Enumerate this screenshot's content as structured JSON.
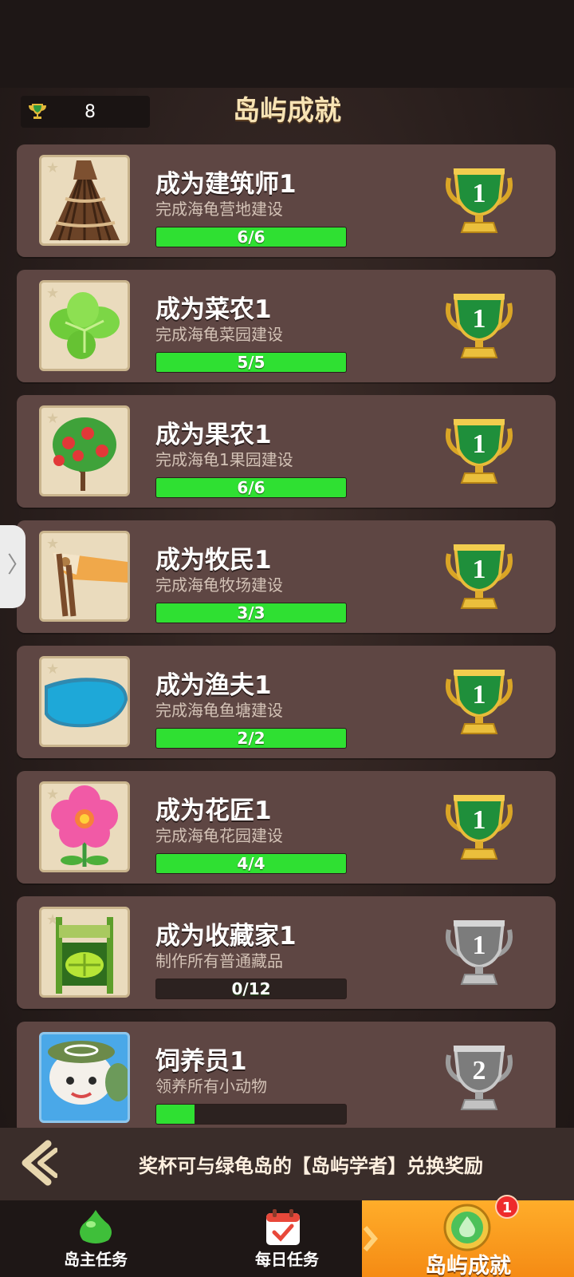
{
  "header": {
    "trophy_count": "8",
    "title": "岛屿成就"
  },
  "achievements": [
    {
      "title": "成为建筑师1",
      "desc": "完成海龟营地建设",
      "progress_text": "6/6",
      "progress": 1.0,
      "trophy_level": "1",
      "trophy_tier": "gold"
    },
    {
      "title": "成为菜农1",
      "desc": "完成海龟菜园建设",
      "progress_text": "5/5",
      "progress": 1.0,
      "trophy_level": "1",
      "trophy_tier": "gold"
    },
    {
      "title": "成为果农1",
      "desc": "完成海龟1果园建设",
      "progress_text": "6/6",
      "progress": 1.0,
      "trophy_level": "1",
      "trophy_tier": "gold"
    },
    {
      "title": "成为牧民1",
      "desc": "完成海龟牧场建设",
      "progress_text": "3/3",
      "progress": 1.0,
      "trophy_level": "1",
      "trophy_tier": "gold"
    },
    {
      "title": "成为渔夫1",
      "desc": "完成海龟鱼塘建设",
      "progress_text": "2/2",
      "progress": 1.0,
      "trophy_level": "1",
      "trophy_tier": "gold"
    },
    {
      "title": "成为花匠1",
      "desc": "完成海龟花园建设",
      "progress_text": "4/4",
      "progress": 1.0,
      "trophy_level": "1",
      "trophy_tier": "gold"
    },
    {
      "title": "成为收藏家1",
      "desc": "制作所有普通藏品",
      "progress_text": "0/12",
      "progress": 0.0,
      "trophy_level": "1",
      "trophy_tier": "silver"
    },
    {
      "title": "饲养员1",
      "desc": "领养所有小动物",
      "progress_text": "",
      "progress": 0.2,
      "trophy_level": "2",
      "trophy_tier": "silver"
    }
  ],
  "info_bar": {
    "text": "奖杯可与绿龟岛的【岛屿学者】兑换奖励"
  },
  "bottom_nav": {
    "items": [
      {
        "label": "岛主任务"
      },
      {
        "label": "每日任务"
      },
      {
        "label": "岛屿成就",
        "badge": "1"
      }
    ]
  },
  "colors": {
    "card_bg": "#5e4643",
    "progress_fill": "#2fe032",
    "title_gold": "#f7e3b4",
    "active_tab": "#f58b14",
    "badge_red": "#ee2b2b"
  }
}
